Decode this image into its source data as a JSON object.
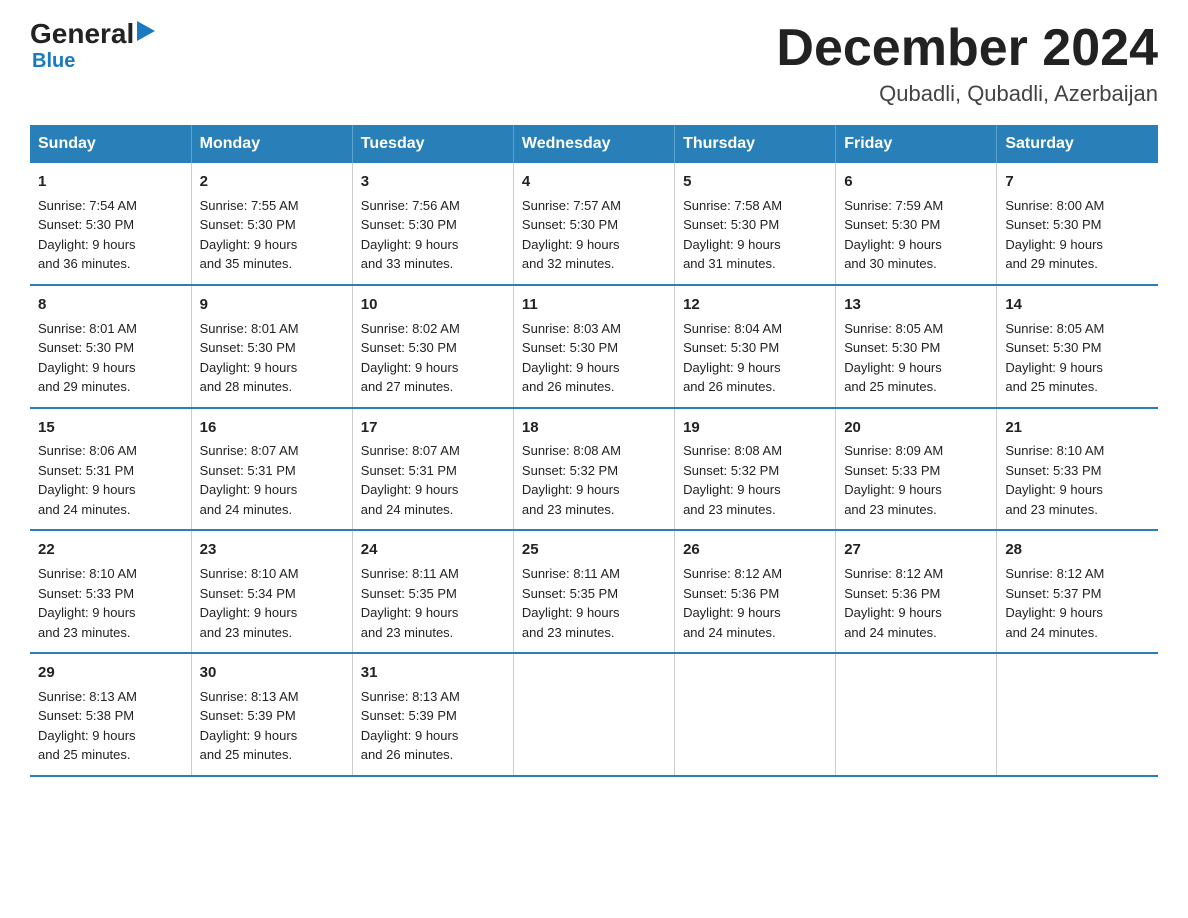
{
  "logo": {
    "general": "General",
    "triangle": "▶",
    "blue": "Blue"
  },
  "title": "December 2024",
  "subtitle": "Qubadli, Qubadli, Azerbaijan",
  "days_header": [
    "Sunday",
    "Monday",
    "Tuesday",
    "Wednesday",
    "Thursday",
    "Friday",
    "Saturday"
  ],
  "weeks": [
    [
      {
        "day": "1",
        "sunrise": "7:54 AM",
        "sunset": "5:30 PM",
        "daylight": "9 hours and 36 minutes."
      },
      {
        "day": "2",
        "sunrise": "7:55 AM",
        "sunset": "5:30 PM",
        "daylight": "9 hours and 35 minutes."
      },
      {
        "day": "3",
        "sunrise": "7:56 AM",
        "sunset": "5:30 PM",
        "daylight": "9 hours and 33 minutes."
      },
      {
        "day": "4",
        "sunrise": "7:57 AM",
        "sunset": "5:30 PM",
        "daylight": "9 hours and 32 minutes."
      },
      {
        "day": "5",
        "sunrise": "7:58 AM",
        "sunset": "5:30 PM",
        "daylight": "9 hours and 31 minutes."
      },
      {
        "day": "6",
        "sunrise": "7:59 AM",
        "sunset": "5:30 PM",
        "daylight": "9 hours and 30 minutes."
      },
      {
        "day": "7",
        "sunrise": "8:00 AM",
        "sunset": "5:30 PM",
        "daylight": "9 hours and 29 minutes."
      }
    ],
    [
      {
        "day": "8",
        "sunrise": "8:01 AM",
        "sunset": "5:30 PM",
        "daylight": "9 hours and 29 minutes."
      },
      {
        "day": "9",
        "sunrise": "8:01 AM",
        "sunset": "5:30 PM",
        "daylight": "9 hours and 28 minutes."
      },
      {
        "day": "10",
        "sunrise": "8:02 AM",
        "sunset": "5:30 PM",
        "daylight": "9 hours and 27 minutes."
      },
      {
        "day": "11",
        "sunrise": "8:03 AM",
        "sunset": "5:30 PM",
        "daylight": "9 hours and 26 minutes."
      },
      {
        "day": "12",
        "sunrise": "8:04 AM",
        "sunset": "5:30 PM",
        "daylight": "9 hours and 26 minutes."
      },
      {
        "day": "13",
        "sunrise": "8:05 AM",
        "sunset": "5:30 PM",
        "daylight": "9 hours and 25 minutes."
      },
      {
        "day": "14",
        "sunrise": "8:05 AM",
        "sunset": "5:30 PM",
        "daylight": "9 hours and 25 minutes."
      }
    ],
    [
      {
        "day": "15",
        "sunrise": "8:06 AM",
        "sunset": "5:31 PM",
        "daylight": "9 hours and 24 minutes."
      },
      {
        "day": "16",
        "sunrise": "8:07 AM",
        "sunset": "5:31 PM",
        "daylight": "9 hours and 24 minutes."
      },
      {
        "day": "17",
        "sunrise": "8:07 AM",
        "sunset": "5:31 PM",
        "daylight": "9 hours and 24 minutes."
      },
      {
        "day": "18",
        "sunrise": "8:08 AM",
        "sunset": "5:32 PM",
        "daylight": "9 hours and 23 minutes."
      },
      {
        "day": "19",
        "sunrise": "8:08 AM",
        "sunset": "5:32 PM",
        "daylight": "9 hours and 23 minutes."
      },
      {
        "day": "20",
        "sunrise": "8:09 AM",
        "sunset": "5:33 PM",
        "daylight": "9 hours and 23 minutes."
      },
      {
        "day": "21",
        "sunrise": "8:10 AM",
        "sunset": "5:33 PM",
        "daylight": "9 hours and 23 minutes."
      }
    ],
    [
      {
        "day": "22",
        "sunrise": "8:10 AM",
        "sunset": "5:33 PM",
        "daylight": "9 hours and 23 minutes."
      },
      {
        "day": "23",
        "sunrise": "8:10 AM",
        "sunset": "5:34 PM",
        "daylight": "9 hours and 23 minutes."
      },
      {
        "day": "24",
        "sunrise": "8:11 AM",
        "sunset": "5:35 PM",
        "daylight": "9 hours and 23 minutes."
      },
      {
        "day": "25",
        "sunrise": "8:11 AM",
        "sunset": "5:35 PM",
        "daylight": "9 hours and 23 minutes."
      },
      {
        "day": "26",
        "sunrise": "8:12 AM",
        "sunset": "5:36 PM",
        "daylight": "9 hours and 24 minutes."
      },
      {
        "day": "27",
        "sunrise": "8:12 AM",
        "sunset": "5:36 PM",
        "daylight": "9 hours and 24 minutes."
      },
      {
        "day": "28",
        "sunrise": "8:12 AM",
        "sunset": "5:37 PM",
        "daylight": "9 hours and 24 minutes."
      }
    ],
    [
      {
        "day": "29",
        "sunrise": "8:13 AM",
        "sunset": "5:38 PM",
        "daylight": "9 hours and 25 minutes."
      },
      {
        "day": "30",
        "sunrise": "8:13 AM",
        "sunset": "5:39 PM",
        "daylight": "9 hours and 25 minutes."
      },
      {
        "day": "31",
        "sunrise": "8:13 AM",
        "sunset": "5:39 PM",
        "daylight": "9 hours and 26 minutes."
      },
      null,
      null,
      null,
      null
    ]
  ],
  "labels": {
    "sunrise": "Sunrise:",
    "sunset": "Sunset:",
    "daylight": "Daylight:"
  }
}
